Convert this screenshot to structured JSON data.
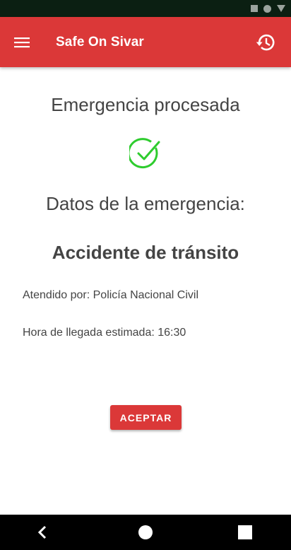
{
  "app_bar": {
    "title": "Safe On Sivar",
    "menu_icon": "hamburger-menu-icon",
    "history_icon": "history-icon"
  },
  "status_bar": {
    "icons": [
      "square-icon",
      "circle-icon",
      "triangle-icon"
    ]
  },
  "main": {
    "heading": "Emergencia procesada",
    "status_icon": "check-circle-icon",
    "data_heading": "Datos de la emergencia:",
    "emergency_type": "Accidente de tránsito",
    "attended_by": "Atendido por: Policía Nacional Civil",
    "estimated_arrival": "Hora de llegada estimada: 16:30",
    "accept_button": "ACEPTAR"
  },
  "nav_bar": {
    "back_icon": "back-icon",
    "home_icon": "home-icon",
    "recents_icon": "recents-icon"
  },
  "colors": {
    "primary": "#db3838",
    "success": "#2ecc2e",
    "text": "#444444",
    "status_bar": "#0b1f12"
  }
}
